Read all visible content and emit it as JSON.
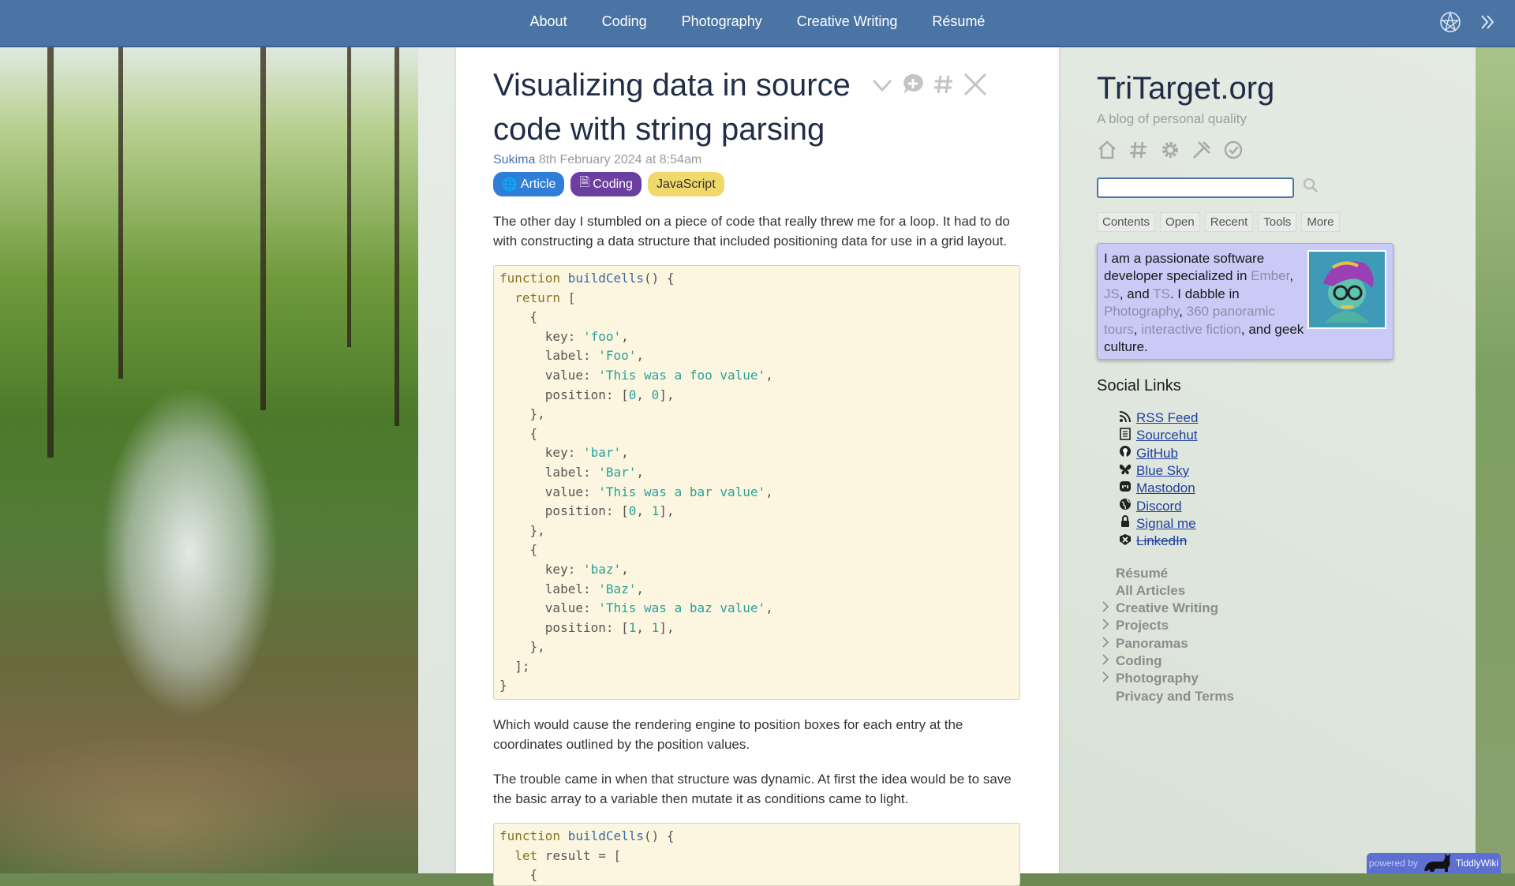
{
  "topnav": {
    "items": [
      "About",
      "Coding",
      "Photography",
      "Creative Writing",
      "Résumé"
    ],
    "icons": [
      "tiddlywiki-logo-icon",
      "double-chevron-right-icon"
    ]
  },
  "article": {
    "title": "Visualizing data in source code with string parsing",
    "author": "Sukima",
    "date": "8th February 2024 at 8:54am",
    "tags": [
      "Article",
      "Coding",
      "JavaScript"
    ],
    "para1": "The other day I stumbled on a piece of code that really threw me for a loop. It had to do with constructing a data structure that included positioning data for use in a grid layout.",
    "para2": "Which would cause the rendering engine to position boxes for each entry at the coordinates outlined by the position values.",
    "para3": "The trouble came in when that structure was dynamic. At first the idea would be to save the basic array to a variable then mutate it as conditions came to light.",
    "code2_line1": "function buildCells() {",
    "code2_line2": "  let result = ["
  },
  "sidebar": {
    "site_title": "TriTarget.org",
    "site_subtitle": "A blog of personal quality",
    "tabs": [
      "Contents",
      "Open",
      "Recent",
      "Tools",
      "More"
    ],
    "about": {
      "t1": "I am a passionate software developer specialized in ",
      "l1": "Ember",
      "t2": ", ",
      "l2": "JS",
      "t3": ", and ",
      "l3": "TS",
      "t4": ". I dabble in ",
      "l4": "Photography",
      "t5": ", ",
      "l5": "360 panoramic tours",
      "t6": ", ",
      "l6": "interactive fiction",
      "t7": ", and geek culture."
    },
    "social_heading": "Social Links",
    "social": [
      {
        "label": "RSS Feed",
        "icon": "rss-icon"
      },
      {
        "label": "Sourcehut",
        "icon": "document-icon"
      },
      {
        "label": "GitHub",
        "icon": "github-icon"
      },
      {
        "label": "Blue Sky",
        "icon": "butterfly-icon"
      },
      {
        "label": "Mastodon",
        "icon": "mastodon-icon"
      },
      {
        "label": "Discord",
        "icon": "globe-icon"
      },
      {
        "label": "Signal me",
        "icon": "lock-icon"
      },
      {
        "label": "LinkedIn",
        "icon": "shield-icon"
      }
    ],
    "toc": [
      {
        "label": "Résumé",
        "expandable": false
      },
      {
        "label": "All Articles",
        "expandable": false
      },
      {
        "label": "Creative Writing",
        "expandable": true
      },
      {
        "label": "Projects",
        "expandable": true
      },
      {
        "label": "Panoramas",
        "expandable": true
      },
      {
        "label": "Coding",
        "expandable": true
      },
      {
        "label": "Photography",
        "expandable": true
      },
      {
        "label": "Privacy and Terms",
        "expandable": false
      }
    ]
  },
  "badge": {
    "powered": "powered by",
    "name": "TiddlyWiki"
  },
  "colors": {
    "topbar": "#4a74a4",
    "tag_article": "#2f7ed8",
    "tag_coding": "#6a3fa0",
    "tag_js": "#f0d96a",
    "about_box": "#c9caf5"
  }
}
